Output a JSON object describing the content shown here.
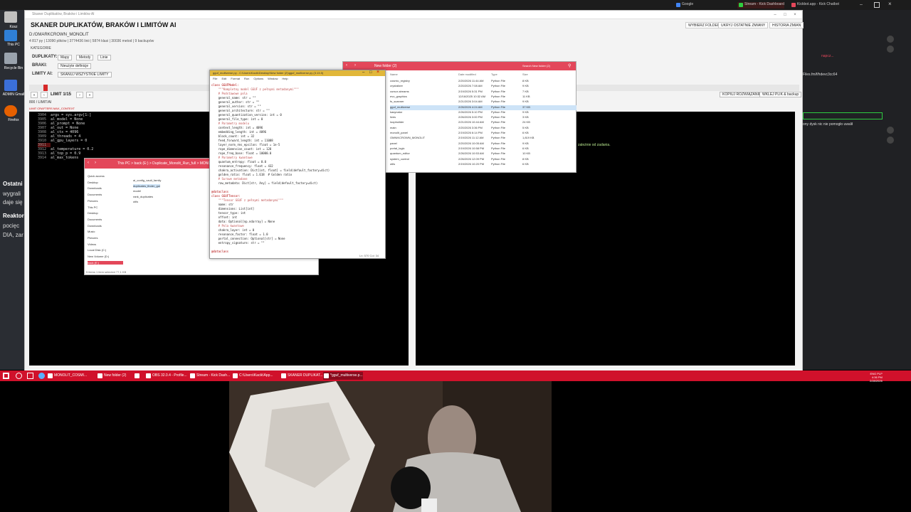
{
  "top_bar": {
    "tabs": [
      {
        "label": "Google",
        "color": "#4285f4"
      },
      {
        "label": "Stream - Kick Dashboard",
        "color": "#2ecc40"
      },
      {
        "label": "Kickbot.app - Kick Chatbot",
        "color": "#e3475a"
      }
    ]
  },
  "desktop": {
    "icons": [
      {
        "label": "Kosz",
        "color": "#c0c0c0"
      },
      {
        "label": "This PC",
        "color": "#2f7fd6"
      },
      {
        "label": "Recycle Bin",
        "color": "#9aa3ad"
      },
      {
        "label": "ADMIN Gmail",
        "color": "#3b6fd8"
      },
      {
        "label": "Firefox",
        "color": "#e66000"
      }
    ],
    "snippets": [
      "Ostatni",
      "wygrali",
      "daje się",
      "Reaktor",
      "pocięc",
      "DIA, zar"
    ]
  },
  "main_app": {
    "window_title": "Skaner Duplikatów, Braków i Limitów AI",
    "heading": "SKANER DUPLIKATÓW, BRAKÓW I LIMITÓW AI",
    "path": "D:/OMARKCROWN_MONOLIT",
    "stats": "4 817 py | 13090 plików | 3774436 linii | 5874 klasi | 30036 metod | 9 backupów",
    "header_buttons": [
      "WYBIERZ FOLDER",
      "UKRYJ OSTATNIE ZMIANY",
      "HISTORIA ZMIAN"
    ],
    "kategorie_label": "KATEGORIE",
    "rows": [
      {
        "label": "DUPLIKATY:",
        "chips": [
          "Mapy",
          "Metody",
          "Linie"
        ]
      },
      {
        "label": "BRAKI:",
        "chips": [
          "Nieużyte definicje"
        ]
      },
      {
        "label": "LIMITY AI:",
        "chips": [
          "SKANUJ WSZYSTKIE LIMITY"
        ]
      }
    ],
    "limit_label": "LIMIT 1/15",
    "right_buttons": [
      "KOPIUJ ROZWIĄZANIE",
      "WKLEJ PLIK & backup"
    ],
    "panel_header": "800 / LIMIT/AI",
    "tags": "LIMIT  CRAFTERS  MAX_CONTEXT",
    "code_lines": [
      {
        "num": "3904",
        "text": "args = sys.argv[1:]"
      },
      {
        "num": "3905",
        "text": "al_model = None"
      },
      {
        "num": "3906",
        "text": "al_prompt = None"
      },
      {
        "num": "3907",
        "text": "al_out = None"
      },
      {
        "num": "3908",
        "text": "al_ctx = 4096"
      },
      {
        "num": "3909",
        "text": "al_threads = 4"
      },
      {
        "num": "3910",
        "text": "al_gpu_layers = 0"
      },
      {
        "num": "3911",
        "text": ""
      },
      {
        "num": "3912",
        "text": "al_temperature = 0.2"
      },
      {
        "num": "3913",
        "text": "al_top_p = 0.9"
      },
      {
        "num": "3914",
        "text": "al_max_tokens"
      }
    ]
  },
  "editor": {
    "title": "gguf_multiverse.py - C:\\Users\\Kacik\\Desktop\\New folder (2)\\gguf_multiverse.py (3.13.5)",
    "menu": [
      "File",
      "Edit",
      "Format",
      "Run",
      "Options",
      "Window",
      "Help"
    ],
    "lines": [
      {
        "text": "class GGUFModel:",
        "cls": "kw"
      },
      {
        "text": "    \"\"\"Kompletny model GGUF z pełnymi metadanymi\"\"\"",
        "cls": "cm"
      },
      {
        "text": "    # Podstawowe pola",
        "cls": "cm"
      },
      {
        "text": "    general_name: str = \"\"",
        "cls": ""
      },
      {
        "text": "    general_author: str = \"\"",
        "cls": ""
      },
      {
        "text": "    general_version: str = \"\"",
        "cls": ""
      },
      {
        "text": "    general_architecture: str = \"\"",
        "cls": ""
      },
      {
        "text": "    general_quantization_version: int = 0",
        "cls": ""
      },
      {
        "text": "    general_file_type: int = 0",
        "cls": ""
      },
      {
        "text": "    # Parametry modelu",
        "cls": "cm"
      },
      {
        "text": "    context_length: int = 4096",
        "cls": ""
      },
      {
        "text": "    embedding_length: int = 4096",
        "cls": ""
      },
      {
        "text": "    block_count: int = 32",
        "cls": ""
      },
      {
        "text": "    feed_forward_length: int = 11008",
        "cls": ""
      },
      {
        "text": "    layer_norm_rms_epsilon: float = 1e-5",
        "cls": ""
      },
      {
        "text": "    rope_dimension_count: int = 128",
        "cls": ""
      },
      {
        "text": "    rope_freq_base: float = 10000.0",
        "cls": ""
      },
      {
        "text": "    # Parametry kwantowe",
        "cls": "cm"
      },
      {
        "text": "    quantum_entropy: float = 0.0",
        "cls": ""
      },
      {
        "text": "    resonance_frequency: float = 432",
        "cls": ""
      },
      {
        "text": "    chakra_activation: Dict[int, float] = field(default_factory=dict)",
        "cls": ""
      },
      {
        "text": "    golden_ratio: float = 1.618  # Golden ratio",
        "cls": ""
      },
      {
        "text": "    # Surowe metadane",
        "cls": "cm"
      },
      {
        "text": "    raw_metadata: Dict[str, Any] = field(default_factory=dict)",
        "cls": ""
      },
      {
        "text": "",
        "cls": ""
      },
      {
        "text": "@dataclass",
        "cls": "kw"
      },
      {
        "text": "class GGUFTensor:",
        "cls": "kw"
      },
      {
        "text": "    \"\"\"Tensor GGUF z pełnymi metadanymi\"\"\"",
        "cls": "cm"
      },
      {
        "text": "    name: str",
        "cls": ""
      },
      {
        "text": "    dimensions: List[int]",
        "cls": ""
      },
      {
        "text": "    tensor_type: int",
        "cls": ""
      },
      {
        "text": "    offset: int",
        "cls": ""
      },
      {
        "text": "    data: Optional[np.ndarray] = None",
        "cls": ""
      },
      {
        "text": "    # Pola kwantowe",
        "cls": "cm"
      },
      {
        "text": "    chakra_layer: int = 0",
        "cls": ""
      },
      {
        "text": "    resonance_factor: float = 1.0",
        "cls": ""
      },
      {
        "text": "    portal_connection: Optional[str] = None",
        "cls": ""
      },
      {
        "text": "    entropy_signature: str = \"\"",
        "cls": ""
      },
      {
        "text": "",
        "cls": ""
      },
      {
        "text": "@dataclass",
        "cls": "kw"
      }
    ],
    "status": "Ln: 570  Col: 34"
  },
  "folder_right": {
    "title": "New folder (2)",
    "search_placeholder": "Search New folder (2)",
    "columns": [
      "Name",
      "Date modified",
      "Type",
      "Size"
    ],
    "files": [
      {
        "name": "cosmic_registry",
        "date": "2/20/2026 11:44 AM",
        "type": "Python File",
        "size": "8 KB"
      },
      {
        "name": "crystalizer",
        "date": "2/20/2026 7:08 AM",
        "type": "Python File",
        "size": "9 KB"
      },
      {
        "name": "cursor-streams",
        "date": "2/19/2026 5:31 PM",
        "type": "Python File",
        "size": "7 KB"
      },
      {
        "name": "evo_graphics",
        "date": "12/16/2025 10:32 AM",
        "type": "Python File",
        "size": "11 KB"
      },
      {
        "name": "fs_scanner",
        "date": "2/21/2026 3:04 AM",
        "type": "Python File",
        "size": "9 KB"
      },
      {
        "name": "gguf_multiverse",
        "date": "2/26/2026 4:24 AM",
        "type": "Python File",
        "size": "37 KB"
      },
      {
        "name": "kasynator",
        "date": "2/26/2026 5:10 PM",
        "type": "Python File",
        "size": "9 KB"
      },
      {
        "name": "lives",
        "date": "2/26/2026 3:00 PM",
        "type": "Python File",
        "size": "3 KB"
      },
      {
        "name": "loopbuilder",
        "date": "2/21/2026 10:44 AM",
        "type": "Python File",
        "size": "24 KB"
      },
      {
        "name": "main",
        "date": "2/20/2026 3:36 PM",
        "type": "Python File",
        "size": "5 KB"
      },
      {
        "name": "monolit_panel",
        "date": "2/19/2026 6:14 PM",
        "type": "Python File",
        "size": "6 KB"
      },
      {
        "name": "OMNIKCROWN_MONOLIT",
        "date": "2/19/2026 11:12 AM",
        "type": "Python File",
        "size": "1,819 KB"
      },
      {
        "name": "panel",
        "date": "2/20/2026 10:05 AM",
        "type": "Python File",
        "size": "9 KB"
      },
      {
        "name": "portal_logic",
        "date": "2/19/2026 10:58 PM",
        "type": "Python File",
        "size": "6 KB"
      },
      {
        "name": "quantum_editor",
        "date": "2/26/2026 10:53 AM",
        "type": "Python File",
        "size": "10 KB"
      },
      {
        "name": "system_control",
        "date": "2/26/2026 12:09 PM",
        "type": "Python File",
        "size": "8 KB"
      },
      {
        "name": "utils",
        "date": "2/19/2026 10:20 PM",
        "type": "Python File",
        "size": "6 KB"
      }
    ],
    "status": "18 items"
  },
  "folder_left": {
    "breadcrumb": "This PC  >  back (E:)  >  Duplicate_Monolit_Run_full  >  MONOLIT",
    "nav": [
      "Quick access",
      "Desktop",
      "Downloads",
      "Documents",
      "Pictures",
      "This PC",
      "Desktop",
      "Documents",
      "Downloads",
      "Music",
      "Pictures",
      "Videos",
      "Local Disk (C:)",
      "New Volume (D:)",
      "back (E:)"
    ],
    "files": [
      "ai_config_vault_family",
      "duplicates_finder_gui",
      "model",
      "rank_duplicates",
      "utils"
    ],
    "status": "5 items   1 item selected  77,1 KB"
  },
  "right_panel": {
    "lines": [
      "napcz...",
      "Files.fm/f/hdevc3cc64",
      "ony dysk nic nie pomogło uwalił",
      "zależnie od zadania."
    ]
  },
  "taskbar": {
    "items": [
      "MONOLIT_COSMI...",
      "New folder (2)",
      "",
      "OBS 32.0.4 - Profile...",
      "Stream - Kick Dash...",
      "C:\\Users\\Kacik\\App...",
      "SKANER DUPLIKAT...",
      "*gguf_multiverse.p..."
    ],
    "tray": [
      "4:36 PM",
      "2/28/2026",
      "ENG PLP"
    ]
  }
}
